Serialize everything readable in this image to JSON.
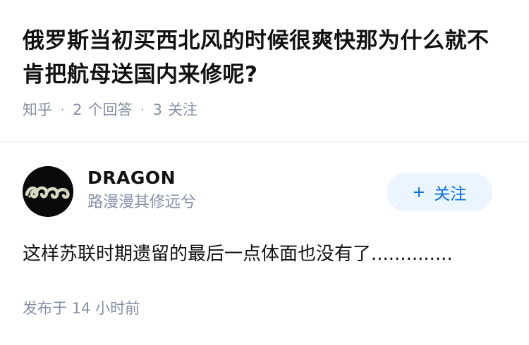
{
  "question": {
    "title": "俄罗斯当初买西北风的时候很爽快那为什么就不肯把航母送国内来修呢?",
    "source": "知乎",
    "answer_count": "2",
    "answer_label": "个回答",
    "follower_count": "3",
    "follower_label": "关注"
  },
  "author": {
    "name": "DRAGON",
    "bio": "路漫漫其修远兮",
    "avatar_icon": "jade-dragon-avatar",
    "follow_label": "关注",
    "follow_icon": "plus-icon"
  },
  "answer": {
    "content": "这样苏联时期遗留的最后一点体面也没有了..............",
    "published_label": "发布于",
    "published_time": "14 小时前"
  },
  "colors": {
    "primary_text": "#121212",
    "secondary_text": "#8590a6",
    "accent": "#056de8",
    "follow_bg": "#ebf5ff",
    "divider": "#ebebeb"
  }
}
